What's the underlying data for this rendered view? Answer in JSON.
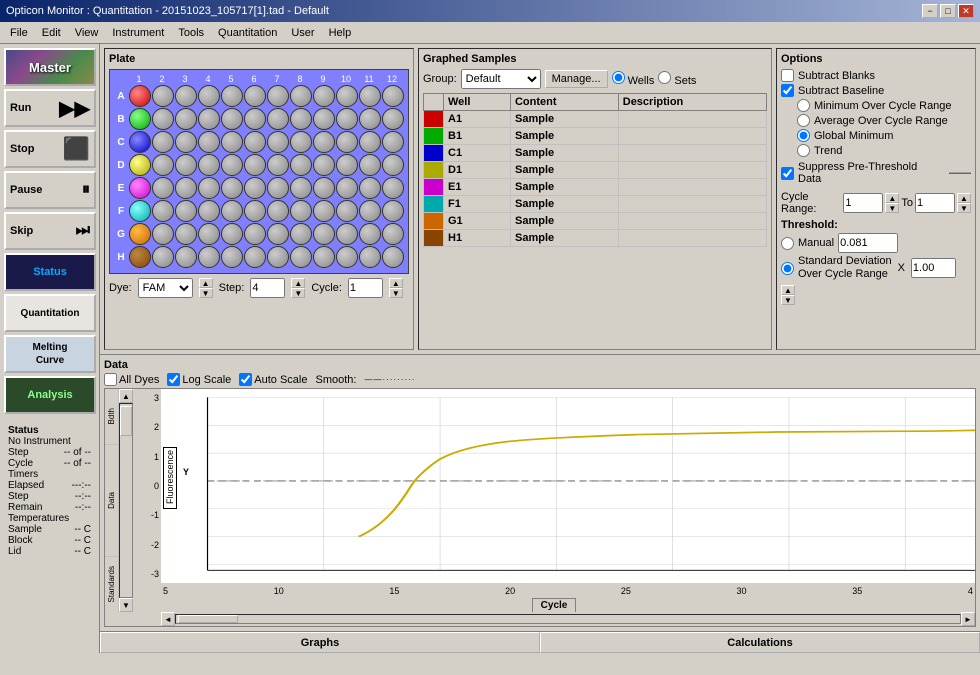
{
  "titlebar": {
    "title": "Opticon Monitor : Quantitation - 20151023_105717[1].tad - Default",
    "min": "−",
    "max": "□",
    "close": "✕"
  },
  "menubar": {
    "items": [
      "File",
      "Edit",
      "View",
      "Instrument",
      "Tools",
      "Quantitation",
      "User",
      "Help"
    ]
  },
  "sidebar": {
    "master": "Master",
    "run": "Run",
    "stop": "Stop",
    "pause": "Pause",
    "skip": "Skip",
    "status": "Status",
    "quantitation": "Quantitation",
    "melting": "Melting\nCurve",
    "analysis": "Analysis"
  },
  "plate": {
    "title": "Plate",
    "col_labels": [
      "1",
      "2",
      "3",
      "4",
      "5",
      "6",
      "7",
      "8",
      "9",
      "10",
      "11",
      "12"
    ],
    "row_labels": [
      "A",
      "B",
      "C",
      "D",
      "E",
      "F",
      "G",
      "H"
    ],
    "dye_label": "Dye:",
    "dye_value": "FAM",
    "step_label": "Step:",
    "step_value": "4",
    "cycle_label": "Cycle:",
    "cycle_value": "1"
  },
  "graphed_samples": {
    "title": "Graphed Samples",
    "group_label": "Group:",
    "group_value": "Default",
    "manage_label": "Manage...",
    "wells_label": "Wells",
    "sets_label": "Sets",
    "table_headers": [
      "Well",
      "Content",
      "Description"
    ],
    "rows": [
      {
        "well": "A1",
        "content": "Sample",
        "description": "",
        "color": "#cc0000"
      },
      {
        "well": "B1",
        "content": "Sample",
        "description": "",
        "color": "#00aa00"
      },
      {
        "well": "C1",
        "content": "Sample",
        "description": "",
        "color": "#0000cc"
      },
      {
        "well": "D1",
        "content": "Sample",
        "description": "",
        "color": "#aaaa00"
      },
      {
        "well": "E1",
        "content": "Sample",
        "description": "",
        "color": "#cc00cc"
      },
      {
        "well": "F1",
        "content": "Sample",
        "description": "",
        "color": "#00aaaa"
      },
      {
        "well": "G1",
        "content": "Sample",
        "description": "",
        "color": "#cc6600"
      },
      {
        "well": "H1",
        "content": "Sample",
        "description": "",
        "color": "#884400"
      }
    ]
  },
  "options": {
    "title": "Options",
    "subtract_blanks": "Subtract Blanks",
    "subtract_baseline": "Subtract Baseline",
    "min_over_cycle": "Minimum Over Cycle Range",
    "avg_over_cycle": "Average Over Cycle Range",
    "global_minimum": "Global Minimum",
    "trend": "Trend",
    "suppress": "Suppress Pre-Threshold Data",
    "cycle_range_label": "Cycle Range:",
    "cycle_from": "1",
    "to_label": "To",
    "cycle_to": "1",
    "threshold_label": "Threshold:",
    "manual_label": "Manual",
    "manual_value": "0.081",
    "sd_label": "Standard Deviation\nOver Cycle Range",
    "sd_x": "X",
    "sd_value": "1.00"
  },
  "data_section": {
    "title": "Data",
    "all_dyes": "All Dyes",
    "log_scale": "Log Scale",
    "auto_scale": "Auto Scale",
    "smooth_label": "Smooth:",
    "y_axis_label": "Fluorescence",
    "x_axis_label": "Cycle",
    "y_values": [
      "3",
      "2",
      "1",
      "0",
      "-1",
      "-2",
      "-3"
    ],
    "x_values": [
      "5",
      "10",
      "15",
      "20",
      "25",
      "30",
      "35",
      "4"
    ],
    "left_labels": [
      "Bdth",
      "Data",
      "Standards"
    ]
  },
  "bottom_bar": {
    "graphs": "Graphs",
    "calculations": "Calculations"
  },
  "status": {
    "title": "Status",
    "instrument": "No Instrument",
    "step_label": "Step",
    "step_value": "-- of --",
    "cycle_label": "Cycle",
    "cycle_value": "-- of --",
    "timers_label": "Timers",
    "elapsed_label": "Elapsed",
    "elapsed_value": "---:--",
    "step_timer_label": "Step",
    "step_timer_value": "--:--",
    "remain_label": "Remain",
    "remain_value": "--:--",
    "temperatures_label": "Temperatures",
    "sample_label": "Sample",
    "sample_value": "-- C",
    "block_label": "Block",
    "block_value": "-- C",
    "lid_label": "Lid",
    "lid_value": "-- C"
  }
}
